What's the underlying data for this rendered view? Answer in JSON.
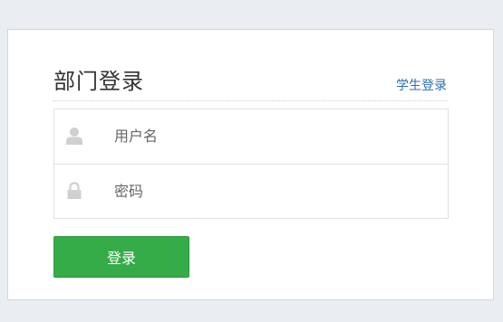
{
  "login": {
    "title": "部门登录",
    "switch_link": "学生登录",
    "username_placeholder": "用户名",
    "password_placeholder": "密码",
    "submit_label": "登录"
  },
  "icons": {
    "username": "user-icon",
    "password": "lock-icon"
  },
  "colors": {
    "background": "#eaeef3",
    "accent_button": "#36ac48",
    "link": "#2a6fb4",
    "icon": "#d0d0d0"
  }
}
